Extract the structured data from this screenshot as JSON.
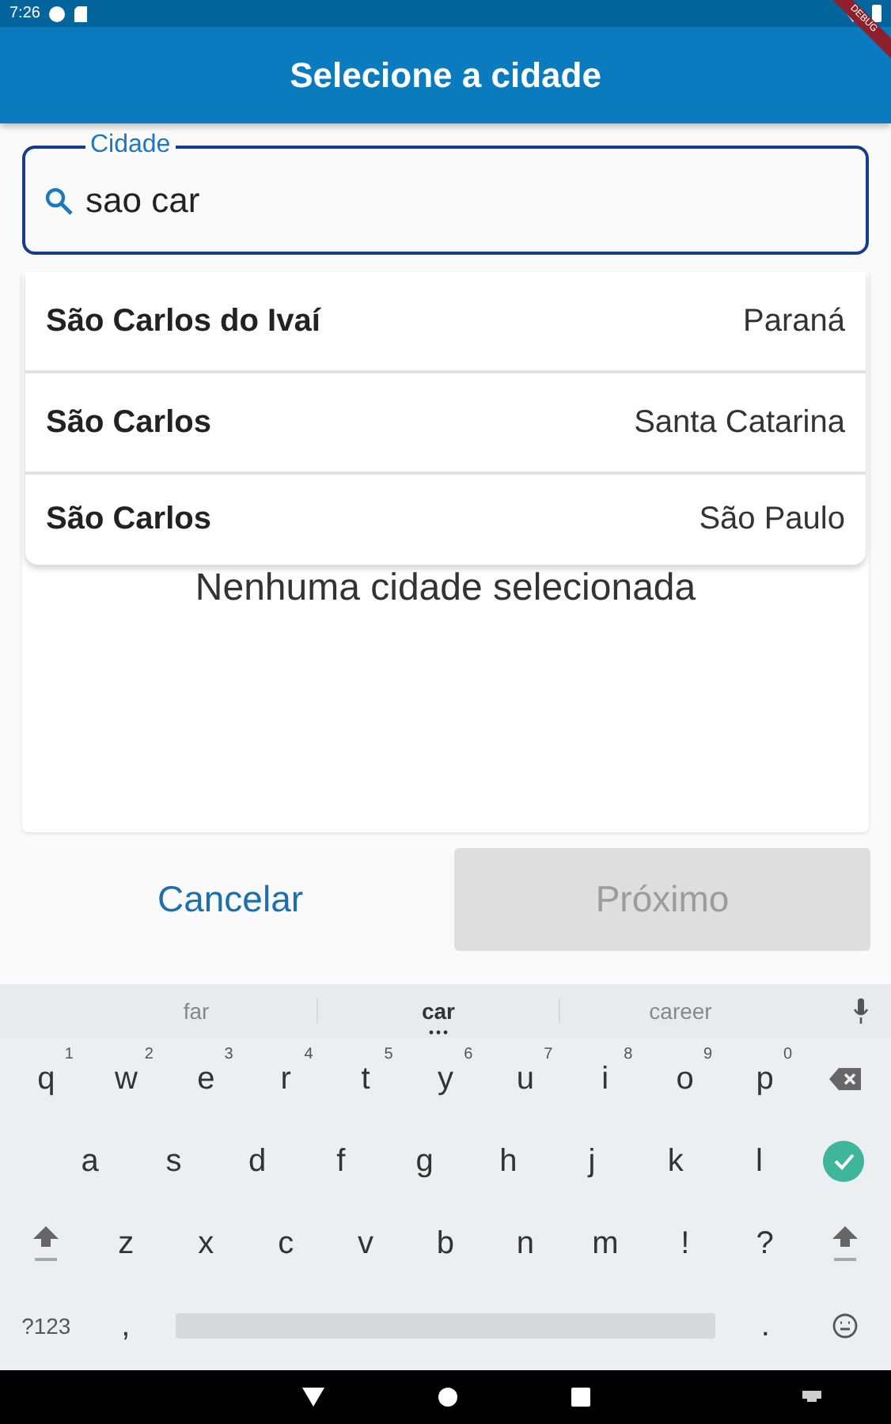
{
  "status_bar": {
    "time": "7:26"
  },
  "debug_banner": "DEBUG",
  "app_bar": {
    "title": "Selecione a cidade"
  },
  "search_field": {
    "label": "Cidade",
    "value": "sao car"
  },
  "suggestions": [
    {
      "city": "São Carlos do Ivaí",
      "state": "Paraná"
    },
    {
      "city": "São Carlos",
      "state": "Santa Catarina"
    },
    {
      "city": "São Carlos",
      "state": "São Paulo"
    }
  ],
  "empty_message": "Nenhuma cidade selecionada",
  "buttons": [
    {
      "label": "Cancelar",
      "kind": "text",
      "disabled": false
    },
    {
      "label": "Próximo",
      "kind": "filled",
      "disabled": true
    }
  ],
  "keyboard": {
    "word_suggestions": [
      {
        "text": "far",
        "selected": false
      },
      {
        "text": "car",
        "selected": true
      },
      {
        "text": "career",
        "selected": false
      }
    ],
    "rows": [
      [
        {
          "kind": "letter",
          "label": "q",
          "hint": "1"
        },
        {
          "kind": "letter",
          "label": "w",
          "hint": "2"
        },
        {
          "kind": "letter",
          "label": "e",
          "hint": "3"
        },
        {
          "kind": "letter",
          "label": "r",
          "hint": "4"
        },
        {
          "kind": "letter",
          "label": "t",
          "hint": "5"
        },
        {
          "kind": "letter",
          "label": "y",
          "hint": "6"
        },
        {
          "kind": "letter",
          "label": "u",
          "hint": "7"
        },
        {
          "kind": "letter",
          "label": "i",
          "hint": "8"
        },
        {
          "kind": "letter",
          "label": "o",
          "hint": "9"
        },
        {
          "kind": "letter",
          "label": "p",
          "hint": "0"
        },
        {
          "kind": "backspace"
        }
      ],
      [
        {
          "kind": "gap"
        },
        {
          "kind": "letter",
          "label": "a"
        },
        {
          "kind": "letter",
          "label": "s"
        },
        {
          "kind": "letter",
          "label": "d"
        },
        {
          "kind": "letter",
          "label": "f"
        },
        {
          "kind": "letter",
          "label": "g"
        },
        {
          "kind": "letter",
          "label": "h"
        },
        {
          "kind": "letter",
          "label": "j"
        },
        {
          "kind": "letter",
          "label": "k"
        },
        {
          "kind": "letter",
          "label": "l"
        },
        {
          "kind": "enter"
        }
      ],
      [
        {
          "kind": "shift"
        },
        {
          "kind": "letter",
          "label": "z"
        },
        {
          "kind": "letter",
          "label": "x"
        },
        {
          "kind": "letter",
          "label": "c"
        },
        {
          "kind": "letter",
          "label": "v"
        },
        {
          "kind": "letter",
          "label": "b"
        },
        {
          "kind": "letter",
          "label": "n"
        },
        {
          "kind": "letter",
          "label": "m"
        },
        {
          "kind": "letter",
          "label": "!"
        },
        {
          "kind": "letter",
          "label": "?"
        },
        {
          "kind": "shift"
        }
      ]
    ],
    "bottom_row": {
      "symbols": "?123",
      "comma": ",",
      "period": "."
    }
  }
}
